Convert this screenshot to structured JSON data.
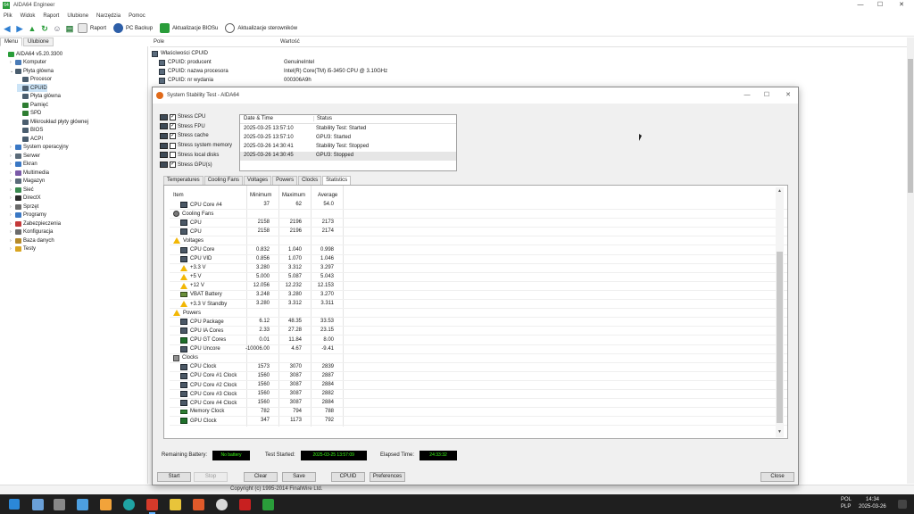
{
  "window": {
    "title": "AIDA64 Engineer",
    "app_icon_label": "64",
    "controls": {
      "minimize": "—",
      "maximize": "☐",
      "close": "✕"
    }
  },
  "menu": [
    "Plik",
    "Widok",
    "Raport",
    "Ulubione",
    "Narzędzia",
    "Pomoc"
  ],
  "toolbar": {
    "buttons": [
      "Raport",
      "PC Backup",
      "Aktualizacje BIOSu",
      "Aktualizacje sterowników"
    ]
  },
  "left_tabs": [
    "Menu",
    "Ulubione"
  ],
  "tree": [
    {
      "label": "AIDA64 v5.20.3300",
      "level": 0,
      "expand": "",
      "icon_color": "#2a9d3a"
    },
    {
      "label": "Komputer",
      "level": 1,
      "expand": "›",
      "icon_color": "#4a7bb7"
    },
    {
      "label": "Płyta główna",
      "level": 1,
      "expand": "⌄",
      "icon_color": "#4a5d6e"
    },
    {
      "label": "Procesor",
      "level": 2,
      "expand": "",
      "icon_color": "#4a5d6e"
    },
    {
      "label": "CPUID",
      "level": 2,
      "expand": "",
      "icon_color": "#4a5d6e",
      "selected": true
    },
    {
      "label": "Płyta główna",
      "level": 2,
      "expand": "",
      "icon_color": "#4a5d6e"
    },
    {
      "label": "Pamięć",
      "level": 2,
      "expand": "",
      "icon_color": "#2e7d32"
    },
    {
      "label": "SPD",
      "level": 2,
      "expand": "",
      "icon_color": "#2e7d32"
    },
    {
      "label": "Mikroukład płyty głównej",
      "level": 2,
      "expand": "",
      "icon_color": "#4a5d6e"
    },
    {
      "label": "BIOS",
      "level": 2,
      "expand": "",
      "icon_color": "#4a5d6e"
    },
    {
      "label": "ACPI",
      "level": 2,
      "expand": "",
      "icon_color": "#4a5d6e"
    },
    {
      "label": "System operacyjny",
      "level": 1,
      "expand": "›",
      "icon_color": "#3a78c4"
    },
    {
      "label": "Serwer",
      "level": 1,
      "expand": "›",
      "icon_color": "#5b6b7a"
    },
    {
      "label": "Ekran",
      "level": 1,
      "expand": "›",
      "icon_color": "#3a78c4"
    },
    {
      "label": "Multimedia",
      "level": 1,
      "expand": "›",
      "icon_color": "#7a5aa8"
    },
    {
      "label": "Magazyn",
      "level": 1,
      "expand": "›",
      "icon_color": "#5b6b7a"
    },
    {
      "label": "Sieć",
      "level": 1,
      "expand": "›",
      "icon_color": "#3a8a50"
    },
    {
      "label": "DirectX",
      "level": 1,
      "expand": "›",
      "icon_color": "#2b2b2b"
    },
    {
      "label": "Sprzęt",
      "level": 1,
      "expand": "›",
      "icon_color": "#6b6b6b"
    },
    {
      "label": "Programy",
      "level": 1,
      "expand": "›",
      "icon_color": "#3a78c4"
    },
    {
      "label": "Zabezpieczenia",
      "level": 1,
      "expand": "›",
      "icon_color": "#c43a3a"
    },
    {
      "label": "Konfiguracja",
      "level": 1,
      "expand": "›",
      "icon_color": "#6b6b6b"
    },
    {
      "label": "Baza danych",
      "level": 1,
      "expand": "›",
      "icon_color": "#b58a2a"
    },
    {
      "label": "Testy",
      "level": 1,
      "expand": "›",
      "icon_color": "#d9a521"
    }
  ],
  "right_panel": {
    "col_field": "Pole",
    "col_value": "Wartość",
    "section": "Właściwości CPUID",
    "rows": [
      {
        "field": "CPUID: producent",
        "value": "GenuineIntel"
      },
      {
        "field": "CPUID: nazwa procesora",
        "value": "Intel(R) Core(TM) i5-3450 CPU @ 3.10GHz"
      },
      {
        "field": "CPUID: nr wydania",
        "value": "000306A9h"
      }
    ]
  },
  "statusbar": {
    "copyright": "Copyright (c) 1995-2014 FinalWire Ltd."
  },
  "dialog": {
    "title": "System Stability Test - AIDA64",
    "controls": {
      "minimize": "—",
      "maximize": "☐",
      "close": "✕"
    },
    "stress_options": [
      {
        "label": "Stress CPU",
        "checked": true
      },
      {
        "label": "Stress FPU",
        "checked": true
      },
      {
        "label": "Stress cache",
        "checked": true
      },
      {
        "label": "Stress system memory",
        "checked": false
      },
      {
        "label": "Stress local disks",
        "checked": false
      },
      {
        "label": "Stress GPU(s)",
        "checked": true
      }
    ],
    "status_table": {
      "col_date": "Date & Time",
      "col_status": "Status",
      "rows": [
        {
          "date": "2025-03-25 13:57:10",
          "status": "Stability Test: Started"
        },
        {
          "date": "2025-03-25 13:57:10",
          "status": "GPU3: Started"
        },
        {
          "date": "2025-03-26 14:30:41",
          "status": "Stability Test: Stopped"
        },
        {
          "date": "2025-03-26 14:30:45",
          "status": "GPU3: Stopped"
        }
      ]
    },
    "tabs": [
      "Temperatures",
      "Cooling Fans",
      "Voltages",
      "Powers",
      "Clocks",
      "Statistics"
    ],
    "active_tab": "Statistics",
    "stats_header": {
      "item": "Item",
      "min": "Minimum",
      "max": "Maximum",
      "avg": "Average"
    },
    "stats_rows": [
      {
        "kind": "item",
        "icon": "cpu",
        "label": "CPU Core #4",
        "min": "37",
        "max": "62",
        "avg": "54.0"
      },
      {
        "kind": "group",
        "icon": "fan",
        "label": "Cooling Fans"
      },
      {
        "kind": "item",
        "icon": "cpu",
        "label": "CPU",
        "min": "2158",
        "max": "2196",
        "avg": "2173"
      },
      {
        "kind": "item",
        "icon": "cpu",
        "label": "CPU",
        "min": "2158",
        "max": "2196",
        "avg": "2174"
      },
      {
        "kind": "group",
        "icon": "warn",
        "label": "Voltages"
      },
      {
        "kind": "item",
        "icon": "cpu",
        "label": "CPU Core",
        "min": "0.832",
        "max": "1.040",
        "avg": "0.998"
      },
      {
        "kind": "item",
        "icon": "cpu",
        "label": "CPU VID",
        "min": "0.856",
        "max": "1.070",
        "avg": "1.046"
      },
      {
        "kind": "item",
        "icon": "warn",
        "label": "+3.3 V",
        "min": "3.280",
        "max": "3.312",
        "avg": "3.297"
      },
      {
        "kind": "item",
        "icon": "warn",
        "label": "+5 V",
        "min": "5.000",
        "max": "5.087",
        "avg": "5.043"
      },
      {
        "kind": "item",
        "icon": "warn",
        "label": "+12 V",
        "min": "12.056",
        "max": "12.232",
        "avg": "12.153"
      },
      {
        "kind": "item",
        "icon": "bat",
        "label": "VBAT Battery",
        "min": "3.248",
        "max": "3.280",
        "avg": "3.270"
      },
      {
        "kind": "item",
        "icon": "warn",
        "label": "+3.3 V Standby",
        "min": "3.280",
        "max": "3.312",
        "avg": "3.311"
      },
      {
        "kind": "group",
        "icon": "warn",
        "label": "Powers"
      },
      {
        "kind": "item",
        "icon": "cpu",
        "label": "CPU Package",
        "min": "6.12",
        "max": "48.35",
        "avg": "33.53"
      },
      {
        "kind": "item",
        "icon": "cpu",
        "label": "CPU IA Cores",
        "min": "2.33",
        "max": "27.28",
        "avg": "23.15"
      },
      {
        "kind": "item",
        "icon": "gpu",
        "label": "CPU GT Cores",
        "min": "0.01",
        "max": "11.84",
        "avg": "8.00"
      },
      {
        "kind": "item",
        "icon": "cpu",
        "label": "CPU Uncore",
        "min": "-10006.00",
        "max": "4.67",
        "avg": "-9.41"
      },
      {
        "kind": "group",
        "icon": "grp",
        "label": "Clocks"
      },
      {
        "kind": "item",
        "icon": "cpu",
        "label": "CPU Clock",
        "min": "1573",
        "max": "3070",
        "avg": "2839"
      },
      {
        "kind": "item",
        "icon": "cpu",
        "label": "CPU Core #1 Clock",
        "min": "1560",
        "max": "3087",
        "avg": "2887"
      },
      {
        "kind": "item",
        "icon": "cpu",
        "label": "CPU Core #2 Clock",
        "min": "1560",
        "max": "3087",
        "avg": "2884"
      },
      {
        "kind": "item",
        "icon": "cpu",
        "label": "CPU Core #3 Clock",
        "min": "1560",
        "max": "3087",
        "avg": "2882"
      },
      {
        "kind": "item",
        "icon": "cpu",
        "label": "CPU Core #4 Clock",
        "min": "1560",
        "max": "3087",
        "avg": "2884"
      },
      {
        "kind": "item",
        "icon": "mem",
        "label": "Memory Clock",
        "min": "782",
        "max": "794",
        "avg": "788"
      },
      {
        "kind": "item",
        "icon": "gpu",
        "label": "GPU Clock",
        "min": "347",
        "max": "1173",
        "avg": "792"
      }
    ],
    "info": {
      "battery_label": "Remaining Battery:",
      "battery_value": "No battery",
      "started_label": "Test Started:",
      "started_value": "2025-03-25 13:57:09",
      "elapsed_label": "Elapsed Time:",
      "elapsed_value": "24:33:32"
    },
    "buttons": {
      "start": "Start",
      "stop": "Stop",
      "clear": "Clear",
      "save": "Save",
      "cpuid": "CPUID",
      "preferences": "Preferences",
      "close": "Close"
    }
  },
  "taskbar": {
    "tray": {
      "lang_top": "POL",
      "lang_bottom": "PLP",
      "time": "14:34",
      "date": "2025-03-26"
    }
  },
  "colors": {
    "accent": "#0078d7",
    "terminal_green": "#39ff14",
    "warning": "#f2b705"
  }
}
